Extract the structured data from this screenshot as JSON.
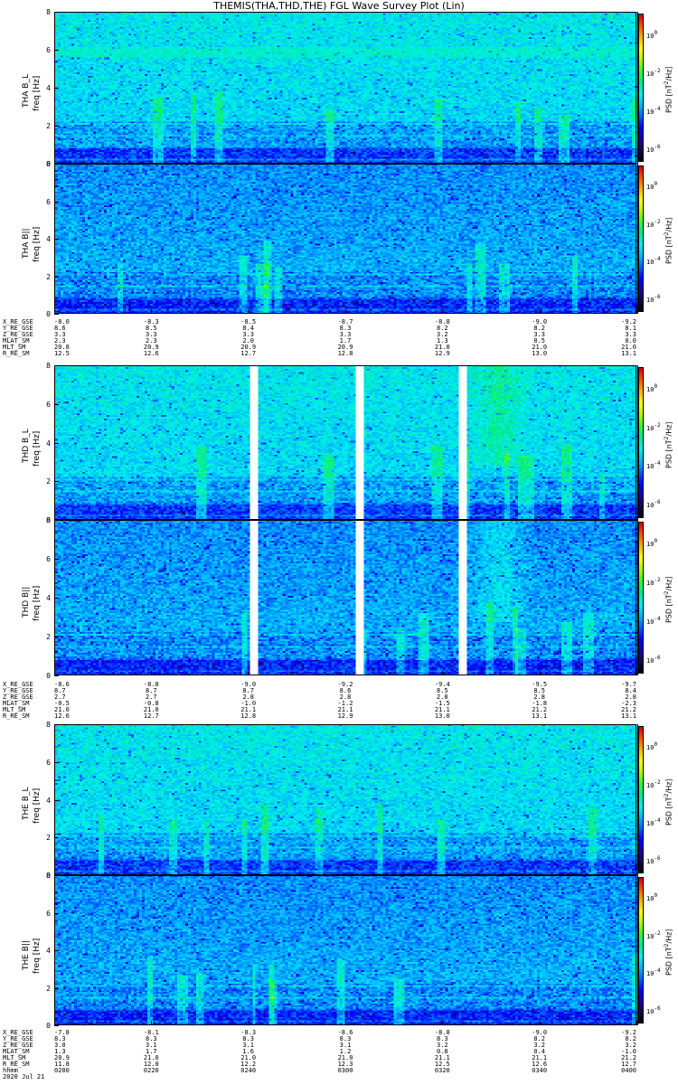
{
  "title": "THEMIS(THA,THD,THE) FGL Wave Survey Plot (Lin)",
  "colors": {
    "colormap": [
      "#000000",
      "#1a0040",
      "#1e00a0",
      "#0000ff",
      "#0060ff",
      "#00b4ff",
      "#00f0f0",
      "#00e890",
      "#30ff30",
      "#b0ff00",
      "#ffff00",
      "#ffb000",
      "#ff5000",
      "#d00000"
    ]
  },
  "chart_data": {
    "type": "heatmap",
    "x_range_utc": [
      "0200",
      "0400"
    ],
    "y_range_hz": [
      0,
      8
    ],
    "y_ticks": [
      "0",
      "2",
      "4",
      "6",
      "8"
    ],
    "colorbar": {
      "label_prefix": "PSD [nT",
      "label_exp": "2",
      "label_suffix": "/Hz]",
      "ticks": [
        {
          "base": "10",
          "exp": "0"
        },
        {
          "base": "10",
          "exp": "-2"
        },
        {
          "base": "10",
          "exp": "-4"
        },
        {
          "base": "10",
          "exp": "-6"
        }
      ]
    },
    "panels": [
      {
        "probe": "THA",
        "component": "B_L",
        "ylabel": "THA B_L",
        "unit": "freq [Hz]",
        "gaps": [],
        "features": "strong band near 6 Hz"
      },
      {
        "probe": "THA",
        "component": "B_II",
        "ylabel": "THA B||",
        "unit": "freq [Hz]",
        "gaps": []
      },
      {
        "probe": "THD",
        "component": "B_L",
        "ylabel": "THD B_L",
        "unit": "freq [Hz]",
        "gaps": [
          0.338,
          0.5205,
          0.6985
        ]
      },
      {
        "probe": "THD",
        "component": "B_II",
        "ylabel": "THD B||",
        "unit": "freq [Hz]",
        "gaps": [
          0.338,
          0.5205,
          0.6985
        ]
      },
      {
        "probe": "THE",
        "component": "B_L",
        "ylabel": "THE B_L",
        "unit": "freq [Hz]",
        "gaps": []
      },
      {
        "probe": "THE",
        "component": "B_II",
        "ylabel": "THE B||",
        "unit": "freq [Hz]",
        "gaps": []
      }
    ]
  },
  "ephemeris": [
    {
      "probe": "THA",
      "rows": [
        {
          "name": "X_RE_GSE",
          "values": [
            "-8.0",
            "-8.3",
            "-8.5",
            "-8.7",
            "-8.8",
            "-9.0",
            "-9.2"
          ]
        },
        {
          "name": "Y_RE_GSE",
          "values": [
            "8.6",
            "8.5",
            "8.4",
            "8.3",
            "8.2",
            "8.2",
            "8.1"
          ]
        },
        {
          "name": "Z_RE_GSE",
          "values": [
            "3.3",
            "3.3",
            "3.3",
            "3.3",
            "3.2",
            "3.3",
            "3.3"
          ]
        },
        {
          "name": "MLAT_SM",
          "values": [
            "2.3",
            "2.3",
            "2.0",
            "1.7",
            "1.3",
            "0.5",
            "0.0"
          ]
        },
        {
          "name": "MLT_SM",
          "values": [
            "20.8",
            "20.9",
            "20.9",
            "20.9",
            "21.0",
            "21.0",
            "21.0"
          ]
        },
        {
          "name": "R_RE_SM",
          "values": [
            "12.5",
            "12.6",
            "12.7",
            "12.8",
            "12.9",
            "13.0",
            "13.1"
          ]
        }
      ]
    },
    {
      "probe": "THD",
      "rows": [
        {
          "name": "X_RE_GSE",
          "values": [
            "-8.6",
            "-8.8",
            "-9.0",
            "-9.2",
            "-9.4",
            "-9.5",
            "-9.7"
          ]
        },
        {
          "name": "Y_RE_GSE",
          "values": [
            "8.7",
            "8.7",
            "8.7",
            "8.6",
            "8.5",
            "8.5",
            "8.4"
          ]
        },
        {
          "name": "Z_RE_GSE",
          "values": [
            "2.7",
            "2.7",
            "2.8",
            "2.8",
            "2.8",
            "2.8",
            "2.8"
          ]
        },
        {
          "name": "MLAT_SM",
          "values": [
            "-0.5",
            "-0.8",
            "-1.0",
            "-1.2",
            "-1.5",
            "-1.8",
            "-2.3"
          ]
        },
        {
          "name": "MLT_SM",
          "values": [
            "21.0",
            "21.0",
            "21.1",
            "21.1",
            "21.1",
            "21.2",
            "21.2"
          ]
        },
        {
          "name": "R_RE_SM",
          "values": [
            "12.6",
            "12.7",
            "12.8",
            "12.9",
            "13.0",
            "13.1",
            "13.1"
          ]
        }
      ]
    },
    {
      "probe": "THE",
      "rows": [
        {
          "name": "X_RE_GSE",
          "values": [
            "-7.8",
            "-8.1",
            "-8.3",
            "-8.6",
            "-8.8",
            "-9.0",
            "-9.2"
          ]
        },
        {
          "name": "Y_RE_GSE",
          "values": [
            "8.3",
            "8.3",
            "8.3",
            "8.3",
            "8.3",
            "8.2",
            "8.2"
          ]
        },
        {
          "name": "Z_RE_GSE",
          "values": [
            "3.0",
            "3.1",
            "3.1",
            "3.1",
            "3.2",
            "3.2",
            "3.2"
          ]
        },
        {
          "name": "MLAT_SM",
          "values": [
            "1.3",
            "1.7",
            "1.6",
            "1.2",
            "0.8",
            "0.4",
            "-1.0"
          ]
        },
        {
          "name": "MLT_SM",
          "values": [
            "20.9",
            "21.0",
            "21.0",
            "21.0",
            "21.1",
            "21.1",
            "21.2"
          ]
        },
        {
          "name": "R_RE_SM",
          "values": [
            "11.8",
            "12.0",
            "12.2",
            "12.3",
            "12.5",
            "12.6",
            "12.7"
          ]
        },
        {
          "name": "hhmm",
          "values": [
            "0200",
            "0220",
            "0240",
            "0300",
            "0320",
            "0340",
            "0400"
          ]
        }
      ]
    }
  ],
  "date": "2020 Jul 21"
}
